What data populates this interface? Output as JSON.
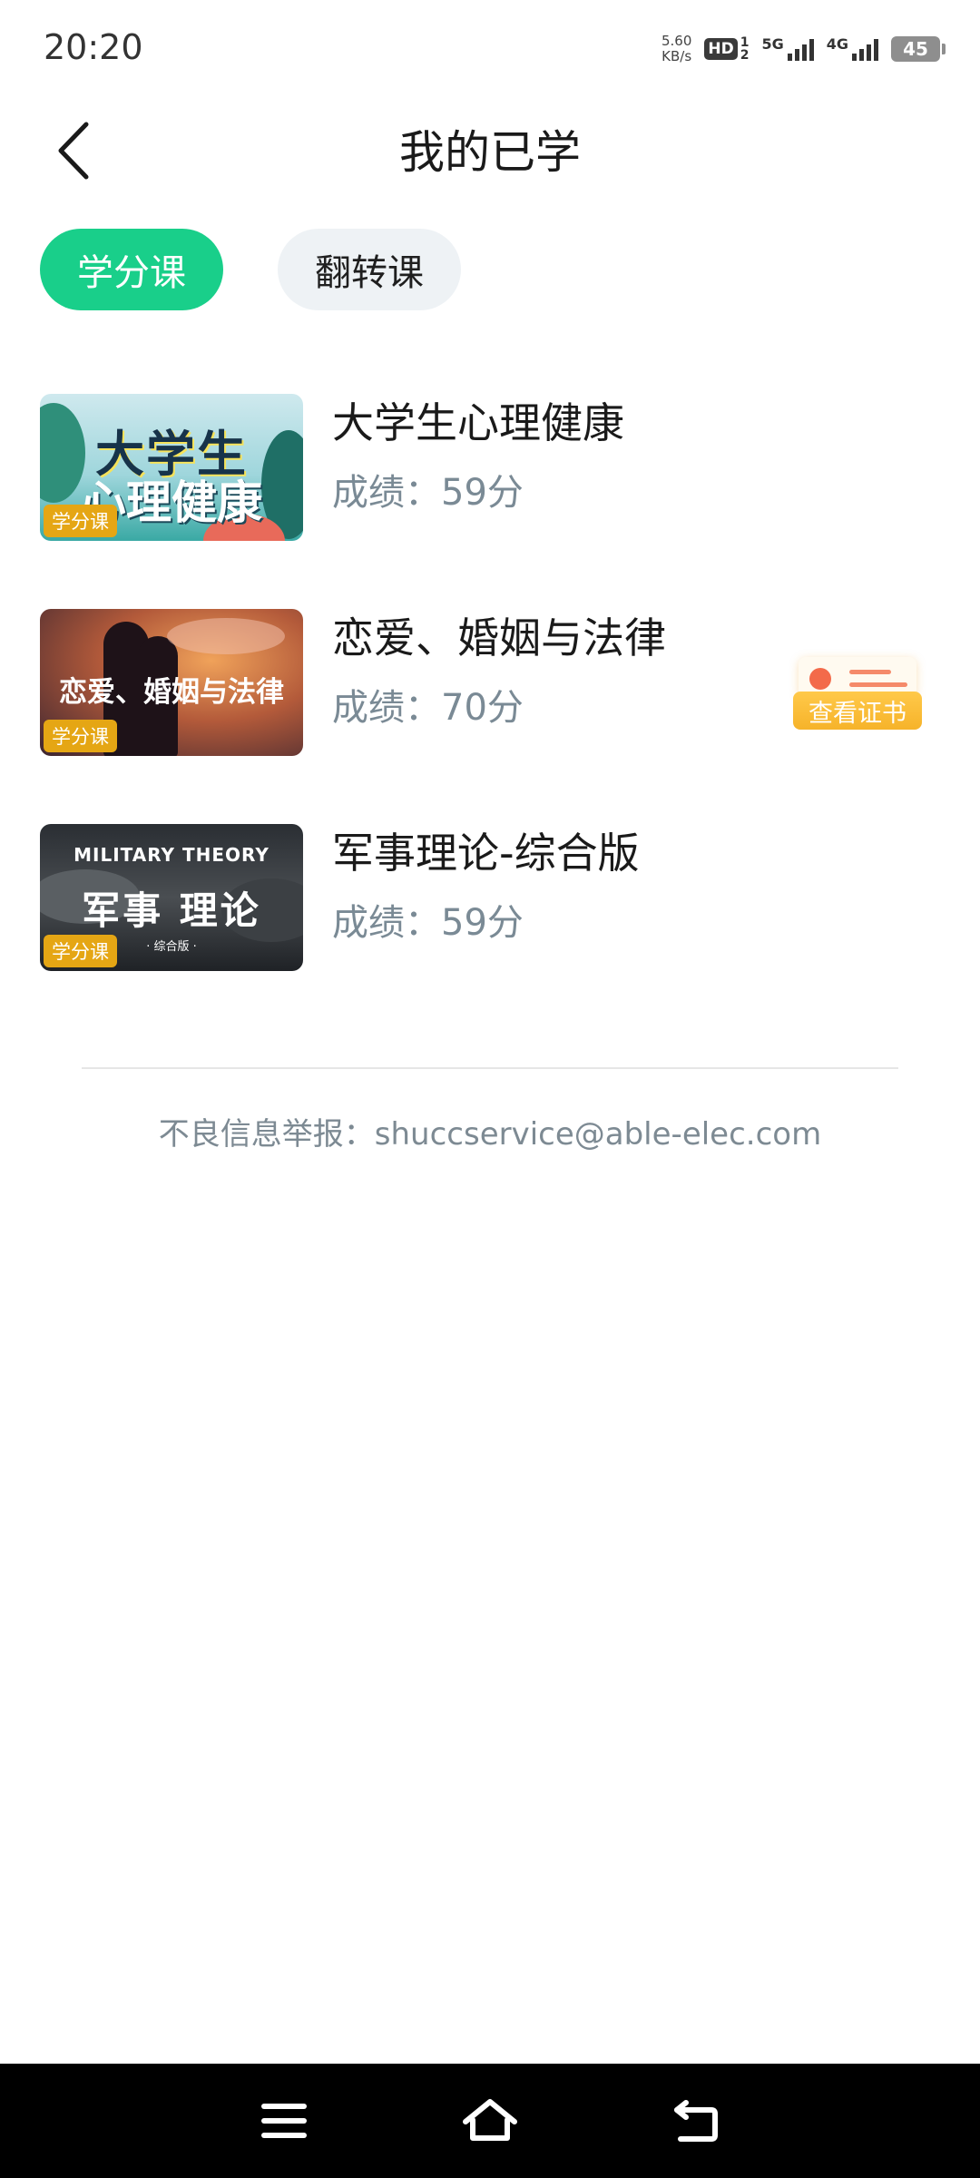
{
  "status_bar": {
    "time": "20:20",
    "net_speed_value": "5.60",
    "net_speed_unit": "KB/s",
    "hd_label": "HD",
    "hd_sub_top": "1",
    "hd_sub_bottom": "2",
    "sim1_label": "5G",
    "sim2_label": "4G",
    "battery_level": "45"
  },
  "header": {
    "title": "我的已学"
  },
  "tabs": [
    {
      "label": "学分课",
      "active": true
    },
    {
      "label": "翻转课",
      "active": false
    }
  ],
  "courses": [
    {
      "name": "大学生心理健康",
      "score": "成绩：59分",
      "badge": "学分课",
      "thumb_line1": "大学生",
      "thumb_line2": "心理健康"
    },
    {
      "name": "恋爱、婚姻与法律",
      "score": "成绩：70分",
      "badge": "学分课",
      "thumb_line1": "恋爱、婚姻与法律"
    },
    {
      "name": "军事理论-综合版",
      "score": "成绩：59分",
      "badge": "学分课",
      "thumb_line0": "MILITARY THEORY",
      "thumb_line1": "军事 理论",
      "thumb_line2": "· 综合版 ·"
    }
  ],
  "certificate_button": {
    "label": "查看证书"
  },
  "footer": {
    "report_text": "不良信息举报：shuccservice@able-elec.com"
  },
  "colors": {
    "accent": "#19cf8a",
    "badge": "#e5a614",
    "certificate": "#f6b32a"
  }
}
